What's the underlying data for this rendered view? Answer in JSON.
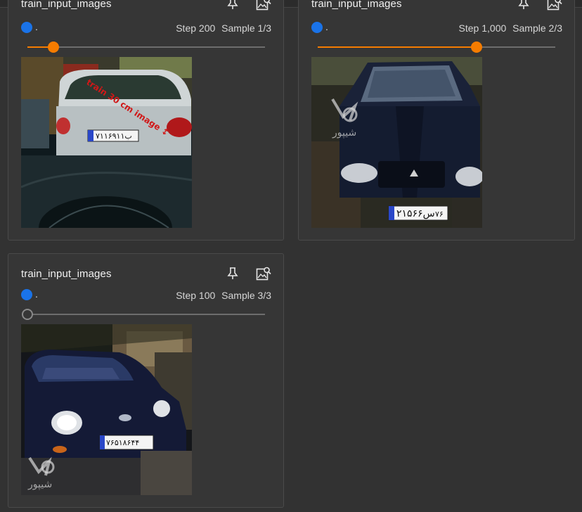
{
  "colors": {
    "run": "#1a73e8",
    "slider_active": "#f57c00"
  },
  "cards": [
    {
      "title": "train_input_images",
      "run_label": ".",
      "step_label": "Step 200",
      "sample_label": "Sample 1/3",
      "slider_fraction": 0.11,
      "plate_text": "۷۱۱۶۹ب۱۱",
      "overlay_text": "train 30 cm image ↕"
    },
    {
      "title": "train_input_images",
      "run_label": ".",
      "step_label": "Step 1,000",
      "sample_label": "Sample 2/3",
      "slider_fraction": 0.67,
      "plate_text": "۲۱س۵۶۶",
      "plate_code": "۷۶",
      "watermark_text": "شیپور"
    },
    {
      "title": "train_input_images",
      "run_label": ".",
      "step_label": "Step 100",
      "sample_label": "Sample 3/3",
      "slider_fraction": 0.0,
      "plate_text": "۷۶۵۱۸۶۴۴",
      "watermark_text": "شیپور"
    }
  ],
  "icons": {
    "pin": "pin-icon",
    "image_search": "image-search-icon"
  }
}
